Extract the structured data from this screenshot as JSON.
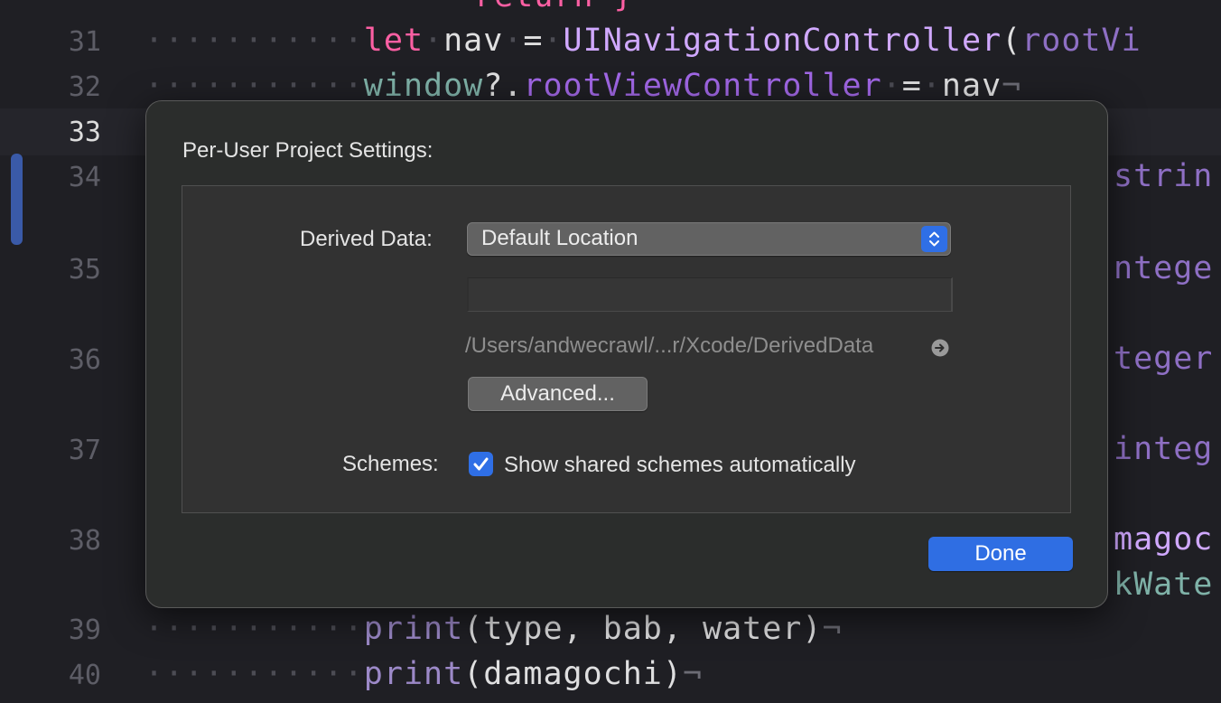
{
  "editor": {
    "line_numbers": [
      "31",
      "32",
      "33",
      "34",
      "35",
      "36",
      "37",
      "38",
      "39",
      "40"
    ],
    "top_partial_code": "return }",
    "line31": {
      "kw": "let",
      "name": "nav",
      "eq": "=",
      "type": "UINavigationController",
      "paren": "(",
      "arg": "rootVi"
    },
    "line32": {
      "obj": "window",
      "op": "?.",
      "prop": "rootViewController",
      "eq": "=",
      "val": "nav"
    },
    "line39": {
      "fn": "print",
      "args": "(type, bab, water)"
    },
    "line40": {
      "fn": "print",
      "args": "(damagochi)"
    },
    "invisible_mark": "¬",
    "right_fragments": [
      "strin",
      "ntege",
      "teger",
      "integ",
      "magoc",
      "kWate"
    ]
  },
  "dialog": {
    "title": "Per-User Project Settings:",
    "derived_data_label": "Derived Data:",
    "derived_data_value": "Default Location",
    "derived_data_custom_path": "",
    "derived_data_path": "/Users/andwecrawl/...r/Xcode/DerivedData",
    "advanced_button": "Advanced...",
    "schemes_label": "Schemes:",
    "schemes_checkbox_label": "Show shared schemes automatically",
    "schemes_checked": true,
    "done_button": "Done"
  },
  "icons": {
    "popup_arrows": "chevron-up-down-icon",
    "reveal": "arrow-circle-right-icon",
    "checkmark": "checkmark-icon"
  },
  "colors": {
    "accent": "#2f6ee3",
    "sheet_background": "#2b2d2c",
    "editor_background": "#1f1f24",
    "keyword": "#fc5fa3"
  }
}
